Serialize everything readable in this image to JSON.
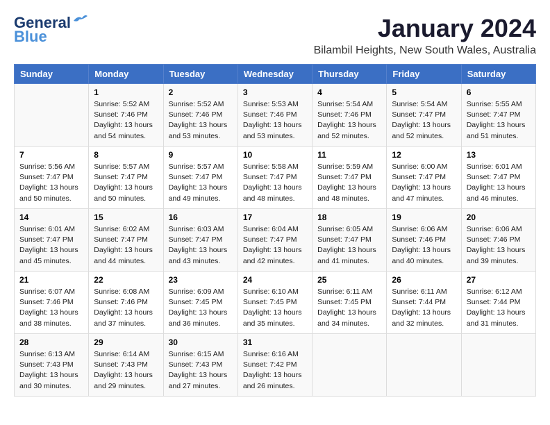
{
  "logo": {
    "line1": "General",
    "line2": "Blue"
  },
  "title": "January 2024",
  "location": "Bilambil Heights, New South Wales, Australia",
  "days_of_week": [
    "Sunday",
    "Monday",
    "Tuesday",
    "Wednesday",
    "Thursday",
    "Friday",
    "Saturday"
  ],
  "weeks": [
    [
      {
        "day": "",
        "content": ""
      },
      {
        "day": "1",
        "content": "Sunrise: 5:52 AM\nSunset: 7:46 PM\nDaylight: 13 hours\nand 54 minutes."
      },
      {
        "day": "2",
        "content": "Sunrise: 5:52 AM\nSunset: 7:46 PM\nDaylight: 13 hours\nand 53 minutes."
      },
      {
        "day": "3",
        "content": "Sunrise: 5:53 AM\nSunset: 7:46 PM\nDaylight: 13 hours\nand 53 minutes."
      },
      {
        "day": "4",
        "content": "Sunrise: 5:54 AM\nSunset: 7:46 PM\nDaylight: 13 hours\nand 52 minutes."
      },
      {
        "day": "5",
        "content": "Sunrise: 5:54 AM\nSunset: 7:47 PM\nDaylight: 13 hours\nand 52 minutes."
      },
      {
        "day": "6",
        "content": "Sunrise: 5:55 AM\nSunset: 7:47 PM\nDaylight: 13 hours\nand 51 minutes."
      }
    ],
    [
      {
        "day": "7",
        "content": "Sunrise: 5:56 AM\nSunset: 7:47 PM\nDaylight: 13 hours\nand 50 minutes."
      },
      {
        "day": "8",
        "content": "Sunrise: 5:57 AM\nSunset: 7:47 PM\nDaylight: 13 hours\nand 50 minutes."
      },
      {
        "day": "9",
        "content": "Sunrise: 5:57 AM\nSunset: 7:47 PM\nDaylight: 13 hours\nand 49 minutes."
      },
      {
        "day": "10",
        "content": "Sunrise: 5:58 AM\nSunset: 7:47 PM\nDaylight: 13 hours\nand 48 minutes."
      },
      {
        "day": "11",
        "content": "Sunrise: 5:59 AM\nSunset: 7:47 PM\nDaylight: 13 hours\nand 48 minutes."
      },
      {
        "day": "12",
        "content": "Sunrise: 6:00 AM\nSunset: 7:47 PM\nDaylight: 13 hours\nand 47 minutes."
      },
      {
        "day": "13",
        "content": "Sunrise: 6:01 AM\nSunset: 7:47 PM\nDaylight: 13 hours\nand 46 minutes."
      }
    ],
    [
      {
        "day": "14",
        "content": "Sunrise: 6:01 AM\nSunset: 7:47 PM\nDaylight: 13 hours\nand 45 minutes."
      },
      {
        "day": "15",
        "content": "Sunrise: 6:02 AM\nSunset: 7:47 PM\nDaylight: 13 hours\nand 44 minutes."
      },
      {
        "day": "16",
        "content": "Sunrise: 6:03 AM\nSunset: 7:47 PM\nDaylight: 13 hours\nand 43 minutes."
      },
      {
        "day": "17",
        "content": "Sunrise: 6:04 AM\nSunset: 7:47 PM\nDaylight: 13 hours\nand 42 minutes."
      },
      {
        "day": "18",
        "content": "Sunrise: 6:05 AM\nSunset: 7:47 PM\nDaylight: 13 hours\nand 41 minutes."
      },
      {
        "day": "19",
        "content": "Sunrise: 6:06 AM\nSunset: 7:46 PM\nDaylight: 13 hours\nand 40 minutes."
      },
      {
        "day": "20",
        "content": "Sunrise: 6:06 AM\nSunset: 7:46 PM\nDaylight: 13 hours\nand 39 minutes."
      }
    ],
    [
      {
        "day": "21",
        "content": "Sunrise: 6:07 AM\nSunset: 7:46 PM\nDaylight: 13 hours\nand 38 minutes."
      },
      {
        "day": "22",
        "content": "Sunrise: 6:08 AM\nSunset: 7:46 PM\nDaylight: 13 hours\nand 37 minutes."
      },
      {
        "day": "23",
        "content": "Sunrise: 6:09 AM\nSunset: 7:45 PM\nDaylight: 13 hours\nand 36 minutes."
      },
      {
        "day": "24",
        "content": "Sunrise: 6:10 AM\nSunset: 7:45 PM\nDaylight: 13 hours\nand 35 minutes."
      },
      {
        "day": "25",
        "content": "Sunrise: 6:11 AM\nSunset: 7:45 PM\nDaylight: 13 hours\nand 34 minutes."
      },
      {
        "day": "26",
        "content": "Sunrise: 6:11 AM\nSunset: 7:44 PM\nDaylight: 13 hours\nand 32 minutes."
      },
      {
        "day": "27",
        "content": "Sunrise: 6:12 AM\nSunset: 7:44 PM\nDaylight: 13 hours\nand 31 minutes."
      }
    ],
    [
      {
        "day": "28",
        "content": "Sunrise: 6:13 AM\nSunset: 7:43 PM\nDaylight: 13 hours\nand 30 minutes."
      },
      {
        "day": "29",
        "content": "Sunrise: 6:14 AM\nSunset: 7:43 PM\nDaylight: 13 hours\nand 29 minutes."
      },
      {
        "day": "30",
        "content": "Sunrise: 6:15 AM\nSunset: 7:43 PM\nDaylight: 13 hours\nand 27 minutes."
      },
      {
        "day": "31",
        "content": "Sunrise: 6:16 AM\nSunset: 7:42 PM\nDaylight: 13 hours\nand 26 minutes."
      },
      {
        "day": "",
        "content": ""
      },
      {
        "day": "",
        "content": ""
      },
      {
        "day": "",
        "content": ""
      }
    ]
  ]
}
